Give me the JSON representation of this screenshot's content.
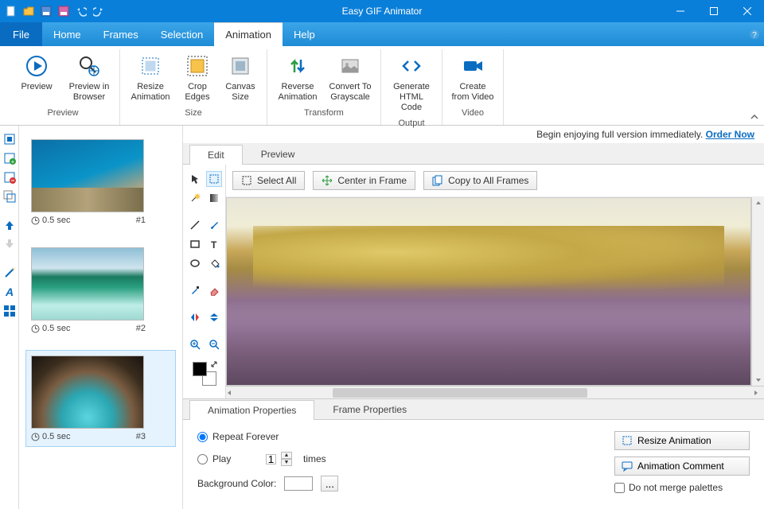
{
  "app_title": "Easy GIF Animator",
  "menubar": {
    "file": "File",
    "home": "Home",
    "frames": "Frames",
    "selection": "Selection",
    "animation": "Animation",
    "help": "Help"
  },
  "ribbon": {
    "groups": {
      "preview": {
        "label": "Preview",
        "preview": "Preview",
        "browser": "Preview in Browser"
      },
      "size": {
        "label": "Size",
        "resize": "Resize Animation",
        "crop": "Crop Edges",
        "canvas": "Canvas Size"
      },
      "transform": {
        "label": "Transform",
        "reverse": "Reverse Animation",
        "gray": "Convert To Grayscale"
      },
      "output": {
        "label": "Output",
        "html": "Generate HTML Code"
      },
      "video": {
        "label": "Video",
        "create": "Create from Video"
      }
    }
  },
  "promo": {
    "text": "Begin enjoying full version immediately. ",
    "link": "Order Now"
  },
  "tabs": {
    "edit": "Edit",
    "preview": "Preview"
  },
  "editbar": {
    "selectall": "Select All",
    "center": "Center in Frame",
    "copy": "Copy to All Frames"
  },
  "frames": [
    {
      "duration": "0.5 sec",
      "index": "#1"
    },
    {
      "duration": "0.5 sec",
      "index": "#2"
    },
    {
      "duration": "0.5 sec",
      "index": "#3"
    }
  ],
  "prop_tabs": {
    "anim": "Animation Properties",
    "frame": "Frame Properties"
  },
  "props": {
    "repeat": "Repeat Forever",
    "play": "Play",
    "times": "times",
    "times_value": "1",
    "bgcolor": "Background Color:",
    "ellipsis": "...",
    "resize_btn": "Resize Animation",
    "comment_btn": "Animation Comment",
    "merge": "Do not merge palettes"
  }
}
